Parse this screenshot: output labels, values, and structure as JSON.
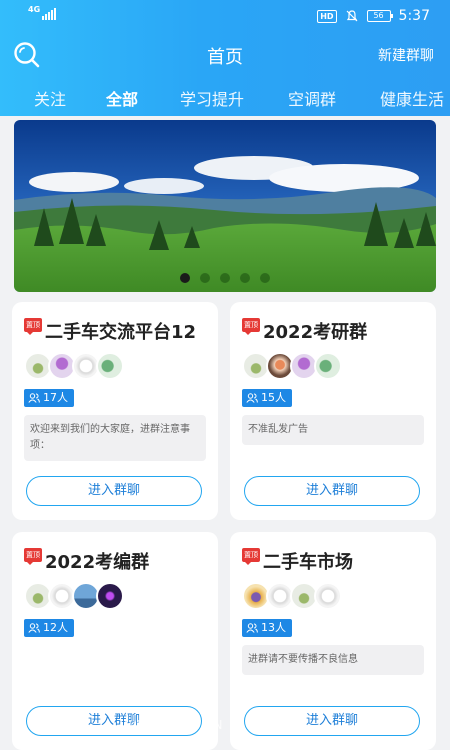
{
  "status_bar": {
    "network": "4G",
    "hd": "HD",
    "battery": "56",
    "time": "5:37"
  },
  "header": {
    "title": "首页",
    "action": "新建群聊"
  },
  "tabs": [
    {
      "label": "关注",
      "active": false
    },
    {
      "label": "全部",
      "active": true
    },
    {
      "label": "学习提升",
      "active": false
    },
    {
      "label": "空调群",
      "active": false
    },
    {
      "label": "健康生活",
      "active": false
    }
  ],
  "banner": {
    "slides": 5,
    "current": 1
  },
  "groups": [
    {
      "badge": "置顶",
      "name": "二手车交流平台12",
      "members": "17人",
      "notice": "欢迎来到我们的大家庭，进群注意事项：",
      "join": "进入群聊"
    },
    {
      "badge": "置顶",
      "name": "2022考研群",
      "members": "15人",
      "notice": "不准乱发广告",
      "join": "进入群聊"
    },
    {
      "badge": "置顶",
      "name": "2022考编群",
      "members": "12人",
      "notice": "",
      "join": "进入群聊"
    },
    {
      "badge": "置顶",
      "name": "二手车市场",
      "members": "13人",
      "notice": "进群请不要传播不良信息",
      "join": "进入群聊"
    }
  ],
  "watermark": "WWW.TCQH.CN",
  "colors": {
    "header_start": "#33bdfb",
    "header_end": "#2d9ef3",
    "accent": "#1e88e5",
    "badge": "#e53935"
  }
}
